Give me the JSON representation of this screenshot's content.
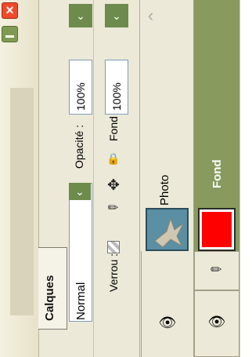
{
  "window": {
    "close_glyph": "×"
  },
  "tab": {
    "label": "Calques"
  },
  "blend": {
    "mode": "Normal",
    "arrow": "⌄"
  },
  "opacity": {
    "label": "Opacité :",
    "value": "100%",
    "arrow": "⌄"
  },
  "lock": {
    "label": "Verrou :",
    "icons": [
      "lock-transparency-icon",
      "lock-brush-icon",
      "lock-move-icon",
      "lock-all-icon"
    ]
  },
  "fill": {
    "label": "Fond :",
    "value": "100%",
    "arrow": "⌄"
  },
  "layers": [
    {
      "name": "Photo",
      "visible": true,
      "selected": false,
      "thumb_color": "#5a8fa4"
    },
    {
      "name": "Fond",
      "visible": true,
      "selected": true,
      "thumb_color": "#ff0000"
    }
  ],
  "colors": {
    "selected_row": "#889a5e",
    "accent": "#6d8b4c",
    "close": "#f04a2a"
  }
}
